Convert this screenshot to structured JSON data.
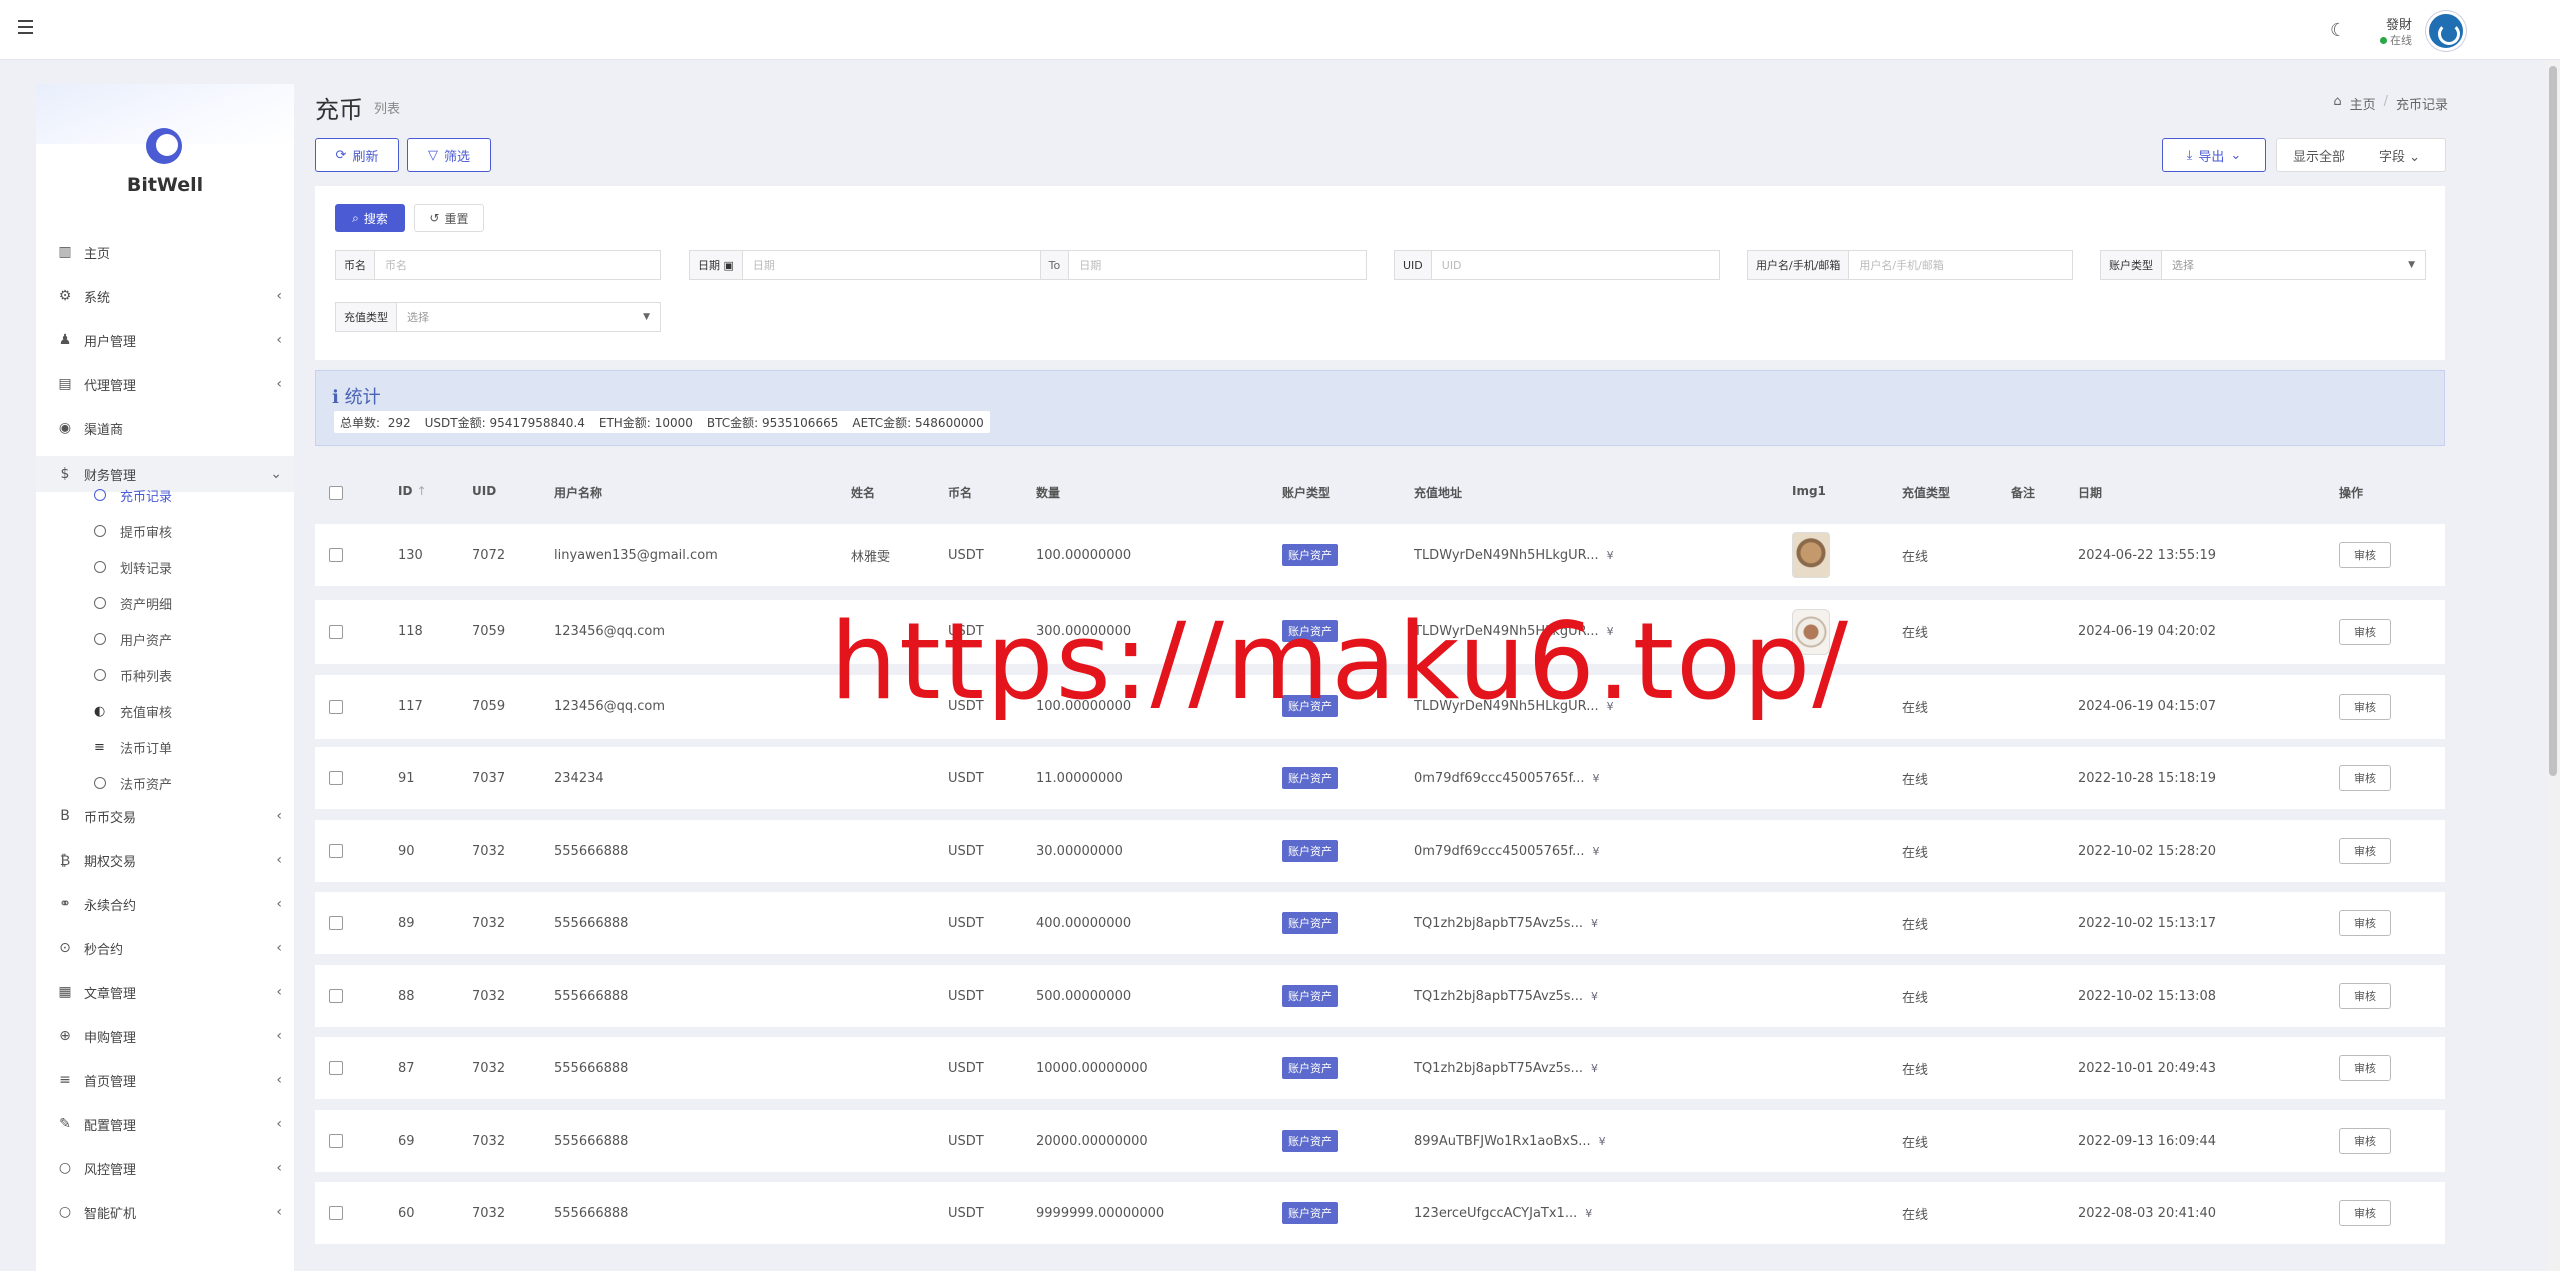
{
  "topbar": {
    "user_name": "發財",
    "user_status": "在线"
  },
  "sidebar": {
    "brand": "BitWell",
    "items": [
      {
        "label": "主页",
        "icon": "bar-chart-icon",
        "has_children": false
      },
      {
        "label": "系统",
        "icon": "gear-icon",
        "has_children": true
      },
      {
        "label": "用户管理",
        "icon": "user-tie-icon",
        "has_children": true
      },
      {
        "label": "代理管理",
        "icon": "id-card-icon",
        "has_children": true
      },
      {
        "label": "渠道商",
        "icon": "user-circle-icon",
        "has_children": false
      },
      {
        "label": "财务管理",
        "icon": "dollar-icon",
        "has_children": true,
        "expanded": true
      },
      {
        "label": "币币交易",
        "icon": "bitcoin-b-icon",
        "has_children": true
      },
      {
        "label": "期权交易",
        "icon": "bitcoin-icon",
        "has_children": true
      },
      {
        "label": "永续合约",
        "icon": "link-icon",
        "has_children": true
      },
      {
        "label": "秒合约",
        "icon": "dot-circle-icon",
        "has_children": true
      },
      {
        "label": "文章管理",
        "icon": "newspaper-icon",
        "has_children": true
      },
      {
        "label": "申购管理",
        "icon": "support-icon",
        "has_children": true
      },
      {
        "label": "首页管理",
        "icon": "list-icon",
        "has_children": true
      },
      {
        "label": "配置管理",
        "icon": "wrench-icon",
        "has_children": true
      },
      {
        "label": "风控管理",
        "icon": "circle-icon",
        "has_children": true
      },
      {
        "label": "智能矿机",
        "icon": "circle-icon",
        "has_children": true
      }
    ],
    "sub_items": [
      {
        "label": "充币记录",
        "icon": "circle-icon",
        "current": true
      },
      {
        "label": "提币审核",
        "icon": "circle-icon"
      },
      {
        "label": "划转记录",
        "icon": "circle-icon"
      },
      {
        "label": "资产明细",
        "icon": "circle-icon"
      },
      {
        "label": "用户资产",
        "icon": "circle-icon"
      },
      {
        "label": "币种列表",
        "icon": "circle-icon"
      },
      {
        "label": "充值审核",
        "icon": "adjust-icon"
      },
      {
        "label": "法币订单",
        "icon": "list-icon"
      },
      {
        "label": "法币资产",
        "icon": "circle-icon"
      }
    ]
  },
  "header": {
    "title": "充币",
    "subtitle": "列表",
    "breadcrumb": [
      "主页",
      "充币记录"
    ]
  },
  "toolbar": {
    "refresh": "刷新",
    "filter": "筛选",
    "export": "导出",
    "show_all": "显示全部",
    "fields": "字段"
  },
  "filters": {
    "search": "搜索",
    "reset": "重置",
    "coin_label": "币名",
    "coin_placeholder": "币名",
    "date_label": "日期",
    "date_start_placeholder": "日期",
    "date_to": "To",
    "date_end_placeholder": "日期",
    "uid_label": "UID",
    "uid_placeholder": "UID",
    "user_label": "用户名/手机/邮箱",
    "user_placeholder": "用户名/手机/邮箱",
    "account_type_label": "账户类型",
    "account_type_value": "选择",
    "recharge_type_label": "充值类型",
    "recharge_type_value": "选择"
  },
  "stats": {
    "title": "统计",
    "total_label": "总单数:",
    "total": "292",
    "usdt_label": "USDT金额:",
    "usdt": "95417958840.4",
    "eth_label": "ETH金额:",
    "eth": "10000",
    "btc_label": "BTC金额:",
    "btc": "9535106665",
    "aetc_label": "AETC金额:",
    "aetc": "548600000"
  },
  "table": {
    "columns": [
      "ID",
      "UID",
      "用户名称",
      "姓名",
      "币名",
      "数量",
      "账户类型",
      "充值地址",
      "Img1",
      "充值类型",
      "备注",
      "日期",
      "操作"
    ],
    "rows": [
      {
        "id": "130",
        "uid": "7072",
        "username": "linyawen135@gmail.com",
        "name": "林雅雯",
        "coin": "USDT",
        "amount": "100.00000000",
        "account_type": "账户资产",
        "address": "TLDWyrDeN49Nh5HLkgUR...",
        "img": "thumb1",
        "recharge_type": "在线",
        "note": "",
        "date": "2024-06-22 13:55:19",
        "action": "审核"
      },
      {
        "id": "118",
        "uid": "7059",
        "username": "123456@qq.com",
        "name": "",
        "coin": "USDT",
        "amount": "300.00000000",
        "account_type": "账户资产",
        "address": "TLDWyrDeN49Nh5HLkgUR...",
        "img": "thumb2",
        "recharge_type": "在线",
        "note": "",
        "date": "2024-06-19 04:20:02",
        "action": "审核"
      },
      {
        "id": "117",
        "uid": "7059",
        "username": "123456@qq.com",
        "name": "",
        "coin": "USDT",
        "amount": "100.00000000",
        "account_type": "账户资产",
        "address": "TLDWyrDeN49Nh5HLkgUR...",
        "img": "",
        "recharge_type": "在线",
        "note": "",
        "date": "2024-06-19 04:15:07",
        "action": "审核"
      },
      {
        "id": "91",
        "uid": "7037",
        "username": "234234",
        "name": "",
        "coin": "USDT",
        "amount": "11.00000000",
        "account_type": "账户资产",
        "address": "0m79df69ccc45005765f...",
        "img": "",
        "recharge_type": "在线",
        "note": "",
        "date": "2022-10-28 15:18:19",
        "action": "审核"
      },
      {
        "id": "90",
        "uid": "7032",
        "username": "555666888",
        "name": "",
        "coin": "USDT",
        "amount": "30.00000000",
        "account_type": "账户资产",
        "address": "0m79df69ccc45005765f...",
        "img": "",
        "recharge_type": "在线",
        "note": "",
        "date": "2022-10-02 15:28:20",
        "action": "审核"
      },
      {
        "id": "89",
        "uid": "7032",
        "username": "555666888",
        "name": "",
        "coin": "USDT",
        "amount": "400.00000000",
        "account_type": "账户资产",
        "address": "TQ1zh2bj8apbT75Avz5s...",
        "img": "",
        "recharge_type": "在线",
        "note": "",
        "date": "2022-10-02 15:13:17",
        "action": "审核"
      },
      {
        "id": "88",
        "uid": "7032",
        "username": "555666888",
        "name": "",
        "coin": "USDT",
        "amount": "500.00000000",
        "account_type": "账户资产",
        "address": "TQ1zh2bj8apbT75Avz5s...",
        "img": "",
        "recharge_type": "在线",
        "note": "",
        "date": "2022-10-02 15:13:08",
        "action": "审核"
      },
      {
        "id": "87",
        "uid": "7032",
        "username": "555666888",
        "name": "",
        "coin": "USDT",
        "amount": "10000.00000000",
        "account_type": "账户资产",
        "address": "TQ1zh2bj8apbT75Avz5s...",
        "img": "",
        "recharge_type": "在线",
        "note": "",
        "date": "2022-10-01 20:49:43",
        "action": "审核"
      },
      {
        "id": "69",
        "uid": "7032",
        "username": "555666888",
        "name": "",
        "coin": "USDT",
        "amount": "20000.00000000",
        "account_type": "账户资产",
        "address": "899AuTBFJWo1Rx1aoBxS...",
        "img": "",
        "recharge_type": "在线",
        "note": "",
        "date": "2022-09-13 16:09:44",
        "action": "审核"
      },
      {
        "id": "60",
        "uid": "7032",
        "username": "555666888",
        "name": "",
        "coin": "USDT",
        "amount": "9999999.00000000",
        "account_type": "账户资产",
        "address": "123erceUfgccACYJaTx1...",
        "img": "",
        "recharge_type": "在线",
        "note": "",
        "date": "2022-08-03 20:41:40",
        "action": "审核"
      }
    ]
  },
  "watermark": "https://maku6.top/",
  "colors": {
    "accent": "#4a5bd4",
    "badge": "#5b6acc",
    "stats_bg": "#dde4f4",
    "watermark": "#e3141c"
  }
}
